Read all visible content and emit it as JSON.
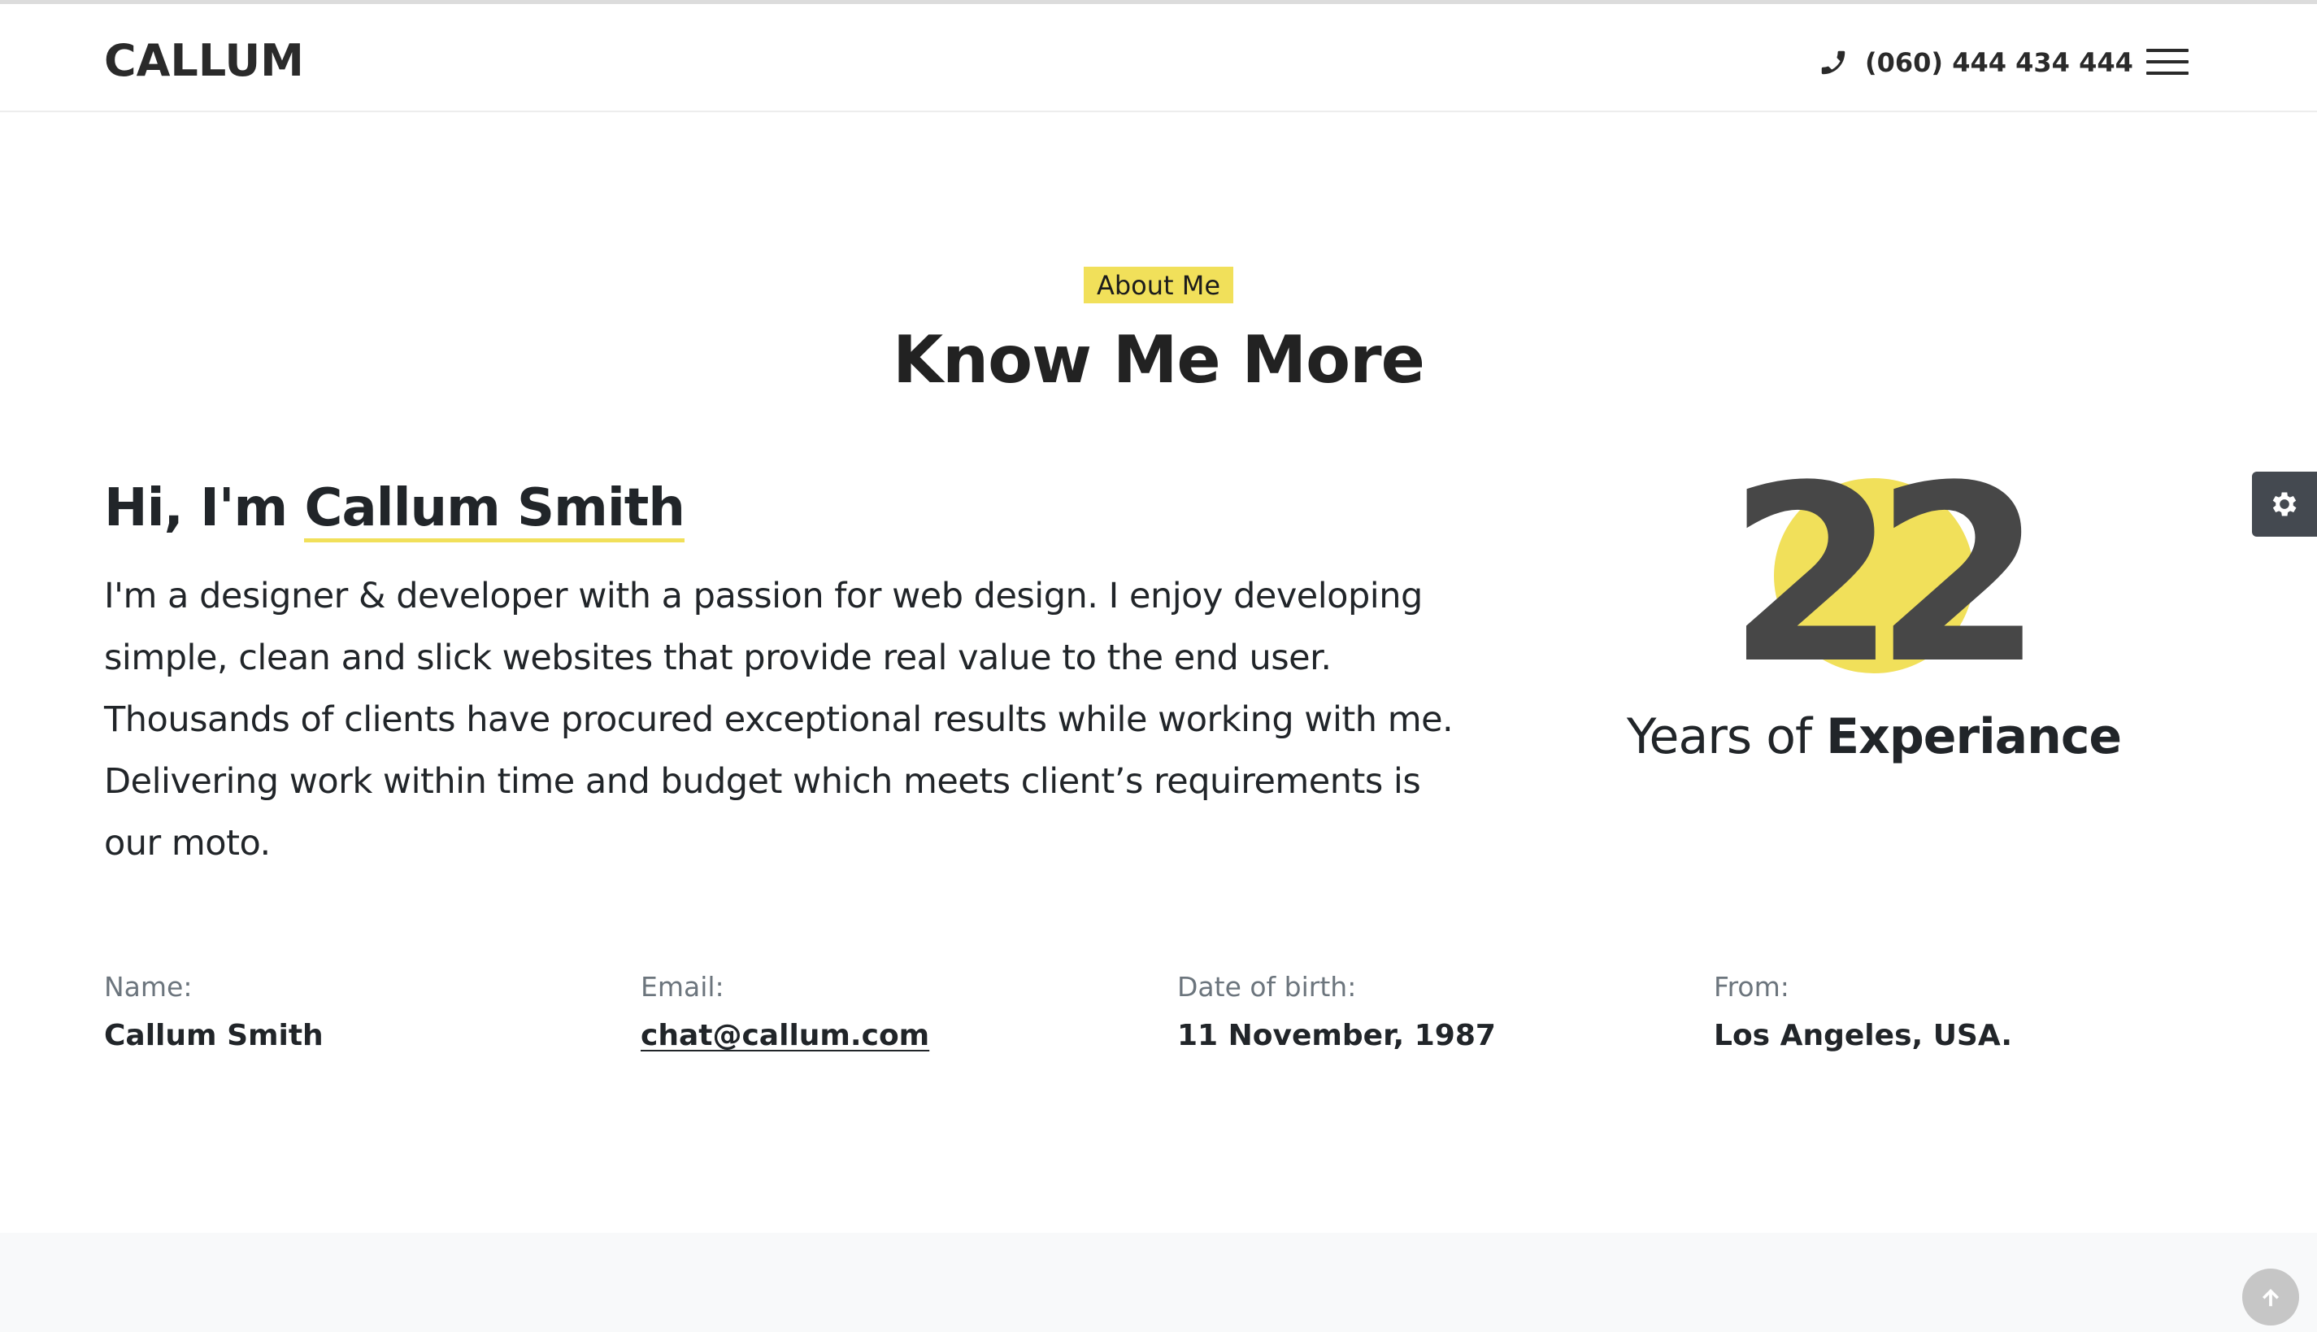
{
  "header": {
    "logo": "CALLUM",
    "phone": "(060) 444 434 444",
    "phone_icon": "phone-icon",
    "menu_icon": "hamburger-menu-icon"
  },
  "about": {
    "eyebrow": "About Me",
    "title": "Know Me More",
    "greeting": "Hi, I'm",
    "name": "Callum Smith",
    "bio": "I'm a designer & developer with a passion for web design. I enjoy developing simple, clean and slick websites that provide real value to the end user. Thousands of clients have procured exceptional results while working with me. Delivering work within time and budget which meets client’s requirements is our moto."
  },
  "experience": {
    "years": "22",
    "label_prefix": "Years of",
    "label_strong": "Experiance"
  },
  "details": [
    {
      "label": "Name:",
      "value": "Callum Smith"
    },
    {
      "label": "Email:",
      "value": "chat@callum.com"
    },
    {
      "label": "Date of birth:",
      "value": "11 November, 1987"
    },
    {
      "label": "From:",
      "value": "Los Angeles, USA."
    }
  ],
  "floating": {
    "settings_icon": "gear-icon",
    "back_to_top_icon": "arrow-up-icon"
  },
  "colors": {
    "accent": "#f1e05a",
    "text_dark": "#212529",
    "muted": "#6c757d",
    "settings_bg": "#444950",
    "back_to_top_bg": "#c6c6c6"
  }
}
